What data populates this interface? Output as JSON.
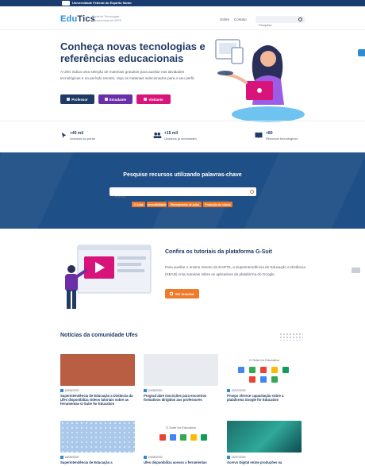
{
  "gov_bar": {
    "text": "Universidade Federal do Espírito Santo"
  },
  "header": {
    "logo_edu": "Edu",
    "logo_tics": "Tics",
    "logo_subtitle": "Portal de Tecnologias Educacionais da UFES",
    "nav": [
      "Sobre",
      "Contato"
    ],
    "search_placeholder": "Pesquise"
  },
  "hero": {
    "title": "Conheça novas tecnologias e referências educacionais",
    "text": "A Ufes indica uma seleção de materiais gratuitos para auxiliar nas atividades tecnológicas e no período remoto. Veja os materiais selecionados para o seu perfil.",
    "buttons": [
      "Professor",
      "Estudante",
      "Visitante"
    ]
  },
  "stats": [
    {
      "num": "+40 mil",
      "label": "Acessos ao portal",
      "icon": "cursor-icon"
    },
    {
      "num": "+15 mil",
      "label": "Usuários já acessaram",
      "icon": "users-icon"
    },
    {
      "num": "+80",
      "label": "Recursos tecnológicos",
      "icon": "book-icon"
    }
  ],
  "search_band": {
    "title": "Pesquise recursos utilizando palavras-chave",
    "placeholder": "Pesquise",
    "tags": [
      "G-Suite",
      "Acessibilidade",
      "Planejamento de aulas",
      "Produção de vídeos"
    ]
  },
  "tutorial": {
    "title": "Confira os tutoriais da plataforma G-Suit",
    "text": "Para auxiliar o ensino remoto do EARTE, a Superintendência de Educação a Distância (SEAD) criou tutoriais sobre os aplicativos da plataforma do Google.",
    "button": "Ver recurso"
  },
  "news": {
    "title": "Notícias da comunidade Ufes",
    "gsuite_label": "G Suite for Education",
    "cards": [
      {
        "date": "18/08/2020",
        "title": "Superintendência de Educação a Distância da Ufes disponibiliza vídeos tutoriais sobre as ferramentas G-Suite for Education"
      },
      {
        "date": "10/08/2020",
        "title": "Prograd abre inscrições para encontros formativos dirigidos aos professores"
      },
      {
        "date": "15/07/2020",
        "title": "Proeps oferece capacitação sobre a plataforma Google for Education"
      },
      {
        "date": "18/08/2020",
        "title": "Superintendência de Educação a"
      },
      {
        "date": "10/08/2020",
        "title": "Ufes disponibiliza acesso a ferramentas"
      },
      {
        "date": "15/07/2020",
        "title": "Acervo Digital reúne produções na"
      }
    ]
  },
  "colors": {
    "navy": "#1f3a64",
    "blue": "#2a8bd8",
    "orange": "#f07a2a",
    "pink": "#d8137a",
    "purple": "#6a2fa8"
  }
}
